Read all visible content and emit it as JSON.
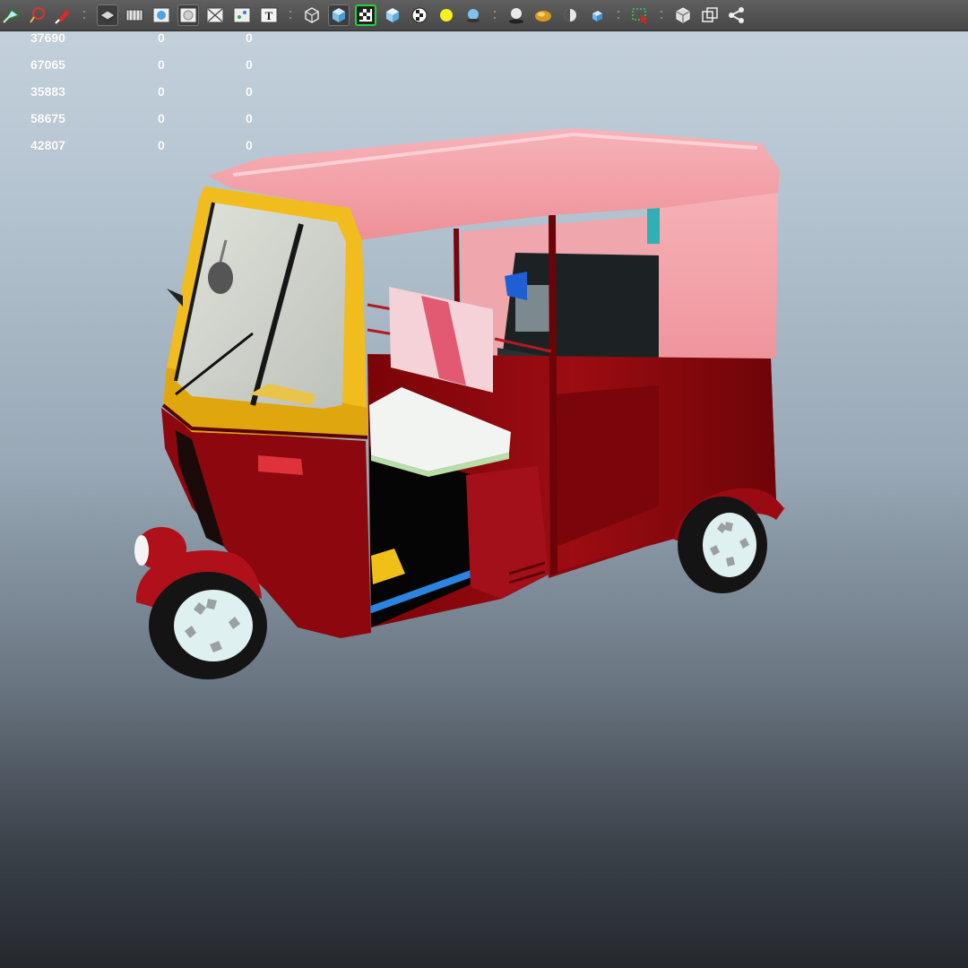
{
  "toolbar": {
    "icons": [
      "select-icon",
      "lasso-select-icon",
      "paint-select-icon",
      "wireframe-mode-icon",
      "film-gate-icon",
      "smooth-shade-icon",
      "flat-shade-icon",
      "xray-icon",
      "uv-layout-icon",
      "text-icon",
      "wireframe-cube-icon",
      "shaded-cube-icon",
      "textured-checker-icon",
      "default-material-cube-icon",
      "checker-texture-icon",
      "default-light-icon",
      "use-all-lights-icon",
      "shadows-icon",
      "ambient-occlusion-icon",
      "motion-blur-icon",
      "anti-alias-icon",
      "region-select-icon",
      "isolate-select-icon",
      "bounding-box-icon",
      "share-icon"
    ],
    "text_icon_glyph": "T"
  },
  "hud": {
    "rows": [
      [
        "37690",
        "0",
        "0"
      ],
      [
        "67065",
        "0",
        "0"
      ],
      [
        "35883",
        "0",
        "0"
      ],
      [
        "58675",
        "0",
        "0"
      ],
      [
        "42807",
        "0",
        "0"
      ]
    ]
  },
  "viewport": {
    "subject": "auto-rickshaw-model",
    "colors": {
      "body": "#8e0a10",
      "roof": "#f2a0a6",
      "trim": "#f2c21d",
      "tyre": "#151515",
      "rim": "#dfeff0"
    }
  }
}
